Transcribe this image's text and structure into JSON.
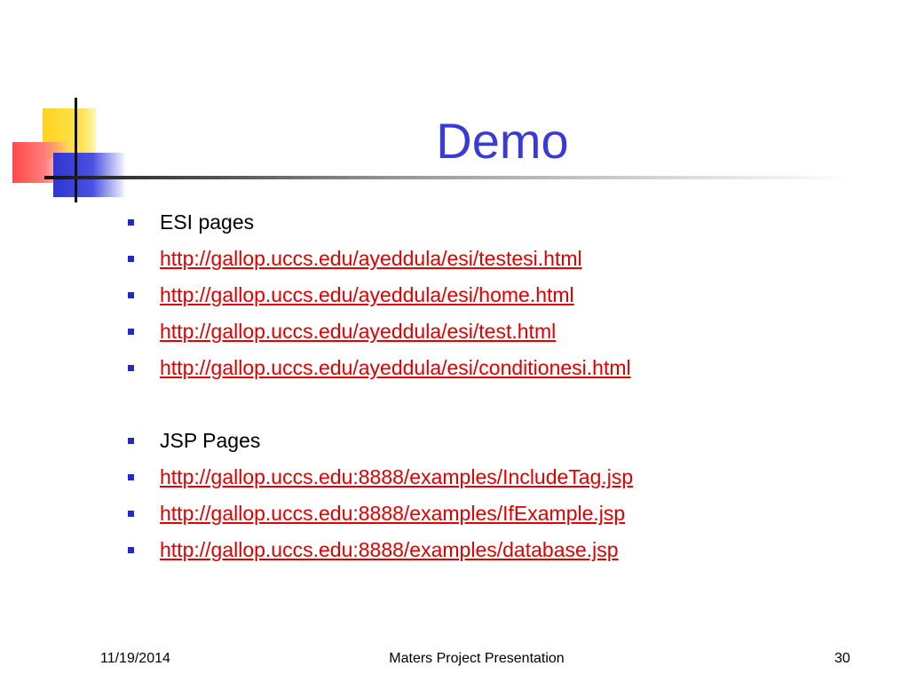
{
  "slide": {
    "title": "Demo",
    "items": [
      {
        "text": "ESI pages",
        "kind": "label"
      },
      {
        "text": "http://gallop.uccs.edu/ayeddula/esi/testesi.html",
        "kind": "link"
      },
      {
        "text": "http://gallop.uccs.edu/ayeddula/esi/home.html",
        "kind": "link"
      },
      {
        "text": "http://gallop.uccs.edu/ayeddula/esi/test.html",
        "kind": "link"
      },
      {
        "text": "http://gallop.uccs.edu/ayeddula/esi/conditionesi.html",
        "kind": "link"
      },
      {
        "text": "JSP Pages",
        "kind": "label"
      },
      {
        "text": "http://gallop.uccs.edu:8888/examples/IncludeTag.jsp",
        "kind": "link"
      },
      {
        "text": "http://gallop.uccs.edu:8888/examples/IfExample.jsp",
        "kind": "link"
      },
      {
        "text": "http://gallop.uccs.edu:8888/examples/database.jsp",
        "kind": "link"
      }
    ]
  },
  "footer": {
    "date": "11/19/2014",
    "presentation": "Maters Project Presentation",
    "page_number": "30"
  },
  "colors": {
    "title": "#3a3ad6",
    "link": "#e00000",
    "bullet": "#2727c8"
  }
}
